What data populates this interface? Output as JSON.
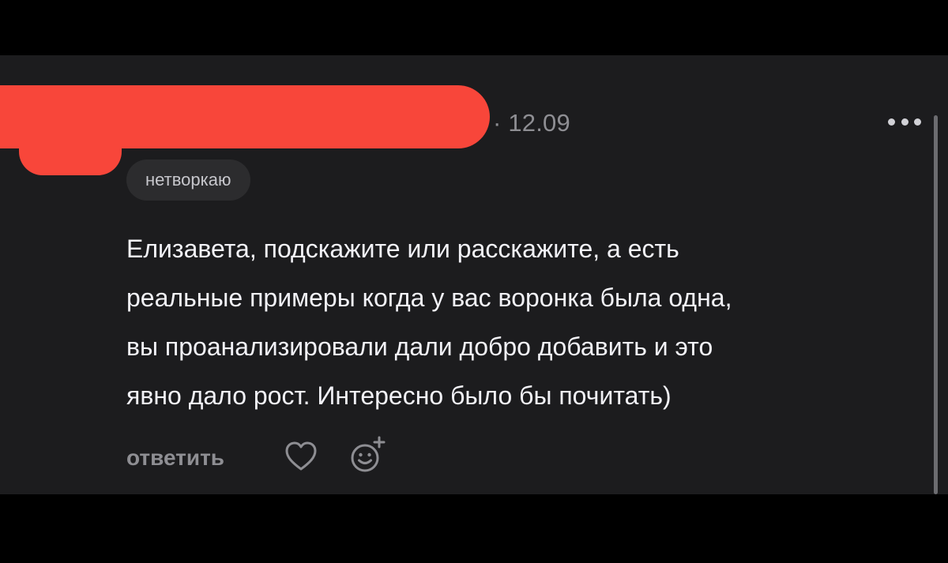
{
  "comment": {
    "date": "· 12.09",
    "tag": "нетворкаю",
    "text": "Елизавета, подскажите или расскажите, а есть\nреальные примеры когда у вас воронка была одна,\nвы проанализировали дали добро добавить и это\nявно дало рост. Интересно было бы почитать)",
    "actions": {
      "reply_label": "ответить",
      "like_icon": "heart-icon",
      "react_icon": "add-reaction-icon"
    },
    "menu_icon": "more-dots-icon"
  },
  "colors": {
    "panel_background": "#1c1c1e",
    "redaction": "#f8463a",
    "text_primary": "#f2f2f7",
    "text_secondary": "#8e8e93"
  }
}
